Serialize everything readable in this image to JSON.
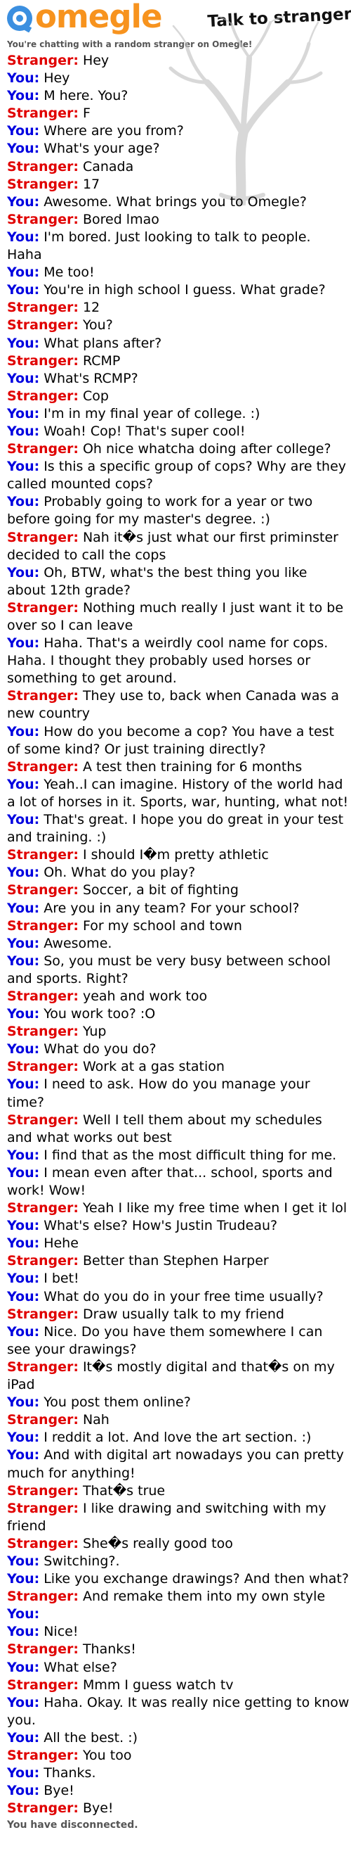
{
  "header": {
    "logo_text": "omegle",
    "tagline": "Talk to strangers!",
    "status_top": "You're chatting with a random stranger on Omegle!"
  },
  "colors": {
    "brand": "#f7931e",
    "stranger": "#e00000",
    "you": "#0000e0",
    "status": "#555555"
  },
  "icons": [
    "omegle-logo-icon",
    "tree-watermark"
  ],
  "messages": [
    {
      "who": "Stranger:",
      "role": "stranger",
      "text": "Hey"
    },
    {
      "who": "You:",
      "role": "you",
      "text": "Hey"
    },
    {
      "who": "You:",
      "role": "you",
      "text": "M here. You?"
    },
    {
      "who": "Stranger:",
      "role": "stranger",
      "text": "F"
    },
    {
      "who": "You:",
      "role": "you",
      "text": "Where are you from?"
    },
    {
      "who": "You:",
      "role": "you",
      "text": "What's your age?"
    },
    {
      "who": "Stranger:",
      "role": "stranger",
      "text": "Canada"
    },
    {
      "who": "Stranger:",
      "role": "stranger",
      "text": "17"
    },
    {
      "who": "You:",
      "role": "you",
      "text": "Awesome. What brings you to Omegle?"
    },
    {
      "who": "Stranger:",
      "role": "stranger",
      "text": "Bored lmao"
    },
    {
      "who": "You:",
      "role": "you",
      "text": "I'm bored. Just looking to talk to people. Haha"
    },
    {
      "who": "You:",
      "role": "you",
      "text": "Me too!"
    },
    {
      "who": "You:",
      "role": "you",
      "text": "You're in high school I guess. What grade?"
    },
    {
      "who": "Stranger:",
      "role": "stranger",
      "text": "12"
    },
    {
      "who": "Stranger:",
      "role": "stranger",
      "text": "You?"
    },
    {
      "who": "You:",
      "role": "you",
      "text": "What plans after?"
    },
    {
      "who": "Stranger:",
      "role": "stranger",
      "text": "RCMP"
    },
    {
      "who": "You:",
      "role": "you",
      "text": "What's RCMP?"
    },
    {
      "who": "Stranger:",
      "role": "stranger",
      "text": "Cop"
    },
    {
      "who": "You:",
      "role": "you",
      "text": "I'm in my final year of college. :)"
    },
    {
      "who": "You:",
      "role": "you",
      "text": "Woah! Cop! That's super cool!"
    },
    {
      "who": "Stranger:",
      "role": "stranger",
      "text": "Oh nice whatcha doing after college?"
    },
    {
      "who": "You:",
      "role": "you",
      "text": "Is this a specific group of cops? Why are they called mounted cops?"
    },
    {
      "who": "You:",
      "role": "you",
      "text": "Probably going to work for a year or two before going for my master's degree. :)"
    },
    {
      "who": "Stranger:",
      "role": "stranger",
      "text": "Nah it�s just what our first priminster decided to call the cops"
    },
    {
      "who": "You:",
      "role": "you",
      "text": "Oh, BTW, what's the best thing you like about 12th grade?"
    },
    {
      "who": "Stranger:",
      "role": "stranger",
      "text": "Nothing much really I just want it to be over so I can leave"
    },
    {
      "who": "You:",
      "role": "you",
      "text": "Haha. That's a weirdly cool name for cops. Haha. I thought they probably used horses or something to get around."
    },
    {
      "who": "Stranger:",
      "role": "stranger",
      "text": "They use to, back when Canada was a new country"
    },
    {
      "who": "You:",
      "role": "you",
      "text": "How do you become a cop? You have a test of some kind? Or just training directly?"
    },
    {
      "who": "Stranger:",
      "role": "stranger",
      "text": "A test then training for 6 months"
    },
    {
      "who": "You:",
      "role": "you",
      "text": "Yeah..I can imagine. History of the world had a lot of horses in it. Sports, war, hunting, what not!"
    },
    {
      "who": "You:",
      "role": "you",
      "text": "That's great. I hope you do great in your test and training. :)"
    },
    {
      "who": "Stranger:",
      "role": "stranger",
      "text": "I should I�m pretty athletic"
    },
    {
      "who": "You:",
      "role": "you",
      "text": "Oh. What do you play?"
    },
    {
      "who": "Stranger:",
      "role": "stranger",
      "text": "Soccer, a bit of fighting"
    },
    {
      "who": "You:",
      "role": "you",
      "text": "Are you in any team? For your school?"
    },
    {
      "who": "Stranger:",
      "role": "stranger",
      "text": "For my school and town"
    },
    {
      "who": "You:",
      "role": "you",
      "text": "Awesome."
    },
    {
      "who": "You:",
      "role": "you",
      "text": "So, you must be very busy between school and sports. Right?"
    },
    {
      "who": "Stranger:",
      "role": "stranger",
      "text": "yeah and work too"
    },
    {
      "who": "You:",
      "role": "you",
      "text": "You work too? :O"
    },
    {
      "who": "Stranger:",
      "role": "stranger",
      "text": "Yup"
    },
    {
      "who": "You:",
      "role": "you",
      "text": "What do you do?"
    },
    {
      "who": "Stranger:",
      "role": "stranger",
      "text": "Work at a gas station"
    },
    {
      "who": "You:",
      "role": "you",
      "text": "I need to ask. How do you manage your time?"
    },
    {
      "who": "Stranger:",
      "role": "stranger",
      "text": "Well I tell them about my schedules and what works out best"
    },
    {
      "who": "You:",
      "role": "you",
      "text": "I find that as the most difficult thing for me."
    },
    {
      "who": "You:",
      "role": "you",
      "text": "I mean even after that... school, sports and work! Wow!"
    },
    {
      "who": "Stranger:",
      "role": "stranger",
      "text": "Yeah I like my free time when I get it lol"
    },
    {
      "who": "You:",
      "role": "you",
      "text": "What's else? How's Justin Trudeau?"
    },
    {
      "who": "You:",
      "role": "you",
      "text": "Hehe"
    },
    {
      "who": "Stranger:",
      "role": "stranger",
      "text": "Better than Stephen Harper"
    },
    {
      "who": "You:",
      "role": "you",
      "text": "I bet!"
    },
    {
      "who": "You:",
      "role": "you",
      "text": "What do you do in your free time usually?"
    },
    {
      "who": "Stranger:",
      "role": "stranger",
      "text": "Draw usually talk to my friend"
    },
    {
      "who": "You:",
      "role": "you",
      "text": "Nice. Do you have them somewhere I can see your drawings?"
    },
    {
      "who": "Stranger:",
      "role": "stranger",
      "text": "It�s mostly digital and that�s on my iPad"
    },
    {
      "who": "You:",
      "role": "you",
      "text": "You post them online?"
    },
    {
      "who": "Stranger:",
      "role": "stranger",
      "text": "Nah"
    },
    {
      "who": "You:",
      "role": "you",
      "text": "I reddit a lot. And love the art section. :)"
    },
    {
      "who": "You:",
      "role": "you",
      "text": "And with digital art nowadays you can pretty much for anything!"
    },
    {
      "who": "Stranger:",
      "role": "stranger",
      "text": "That�s true"
    },
    {
      "who": "Stranger:",
      "role": "stranger",
      "text": "I like drawing and switching with my friend"
    },
    {
      "who": "Stranger:",
      "role": "stranger",
      "text": "She�s really good too"
    },
    {
      "who": "You:",
      "role": "you",
      "text": "Switching?."
    },
    {
      "who": "You:",
      "role": "you",
      "text": "Like you exchange drawings? And then what?"
    },
    {
      "who": "Stranger:",
      "role": "stranger",
      "text": "And remake them into my own style"
    },
    {
      "who": "You:",
      "role": "you",
      "text": ""
    },
    {
      "who": "You:",
      "role": "you",
      "text": "Nice!"
    },
    {
      "who": "Stranger:",
      "role": "stranger",
      "text": "Thanks!"
    },
    {
      "who": "You:",
      "role": "you",
      "text": "What else?"
    },
    {
      "who": "Stranger:",
      "role": "stranger",
      "text": "Mmm I guess watch tv"
    },
    {
      "who": "You:",
      "role": "you",
      "text": "Haha. Okay. It was really nice getting to know you."
    },
    {
      "who": "You:",
      "role": "you",
      "text": "All the best. :)"
    },
    {
      "who": "Stranger:",
      "role": "stranger",
      "text": "You too"
    },
    {
      "who": "You:",
      "role": "you",
      "text": "Thanks."
    },
    {
      "who": "You:",
      "role": "you",
      "text": "Bye!"
    },
    {
      "who": "Stranger:",
      "role": "stranger",
      "text": "Bye!"
    }
  ],
  "status_bottom": "You have disconnected."
}
